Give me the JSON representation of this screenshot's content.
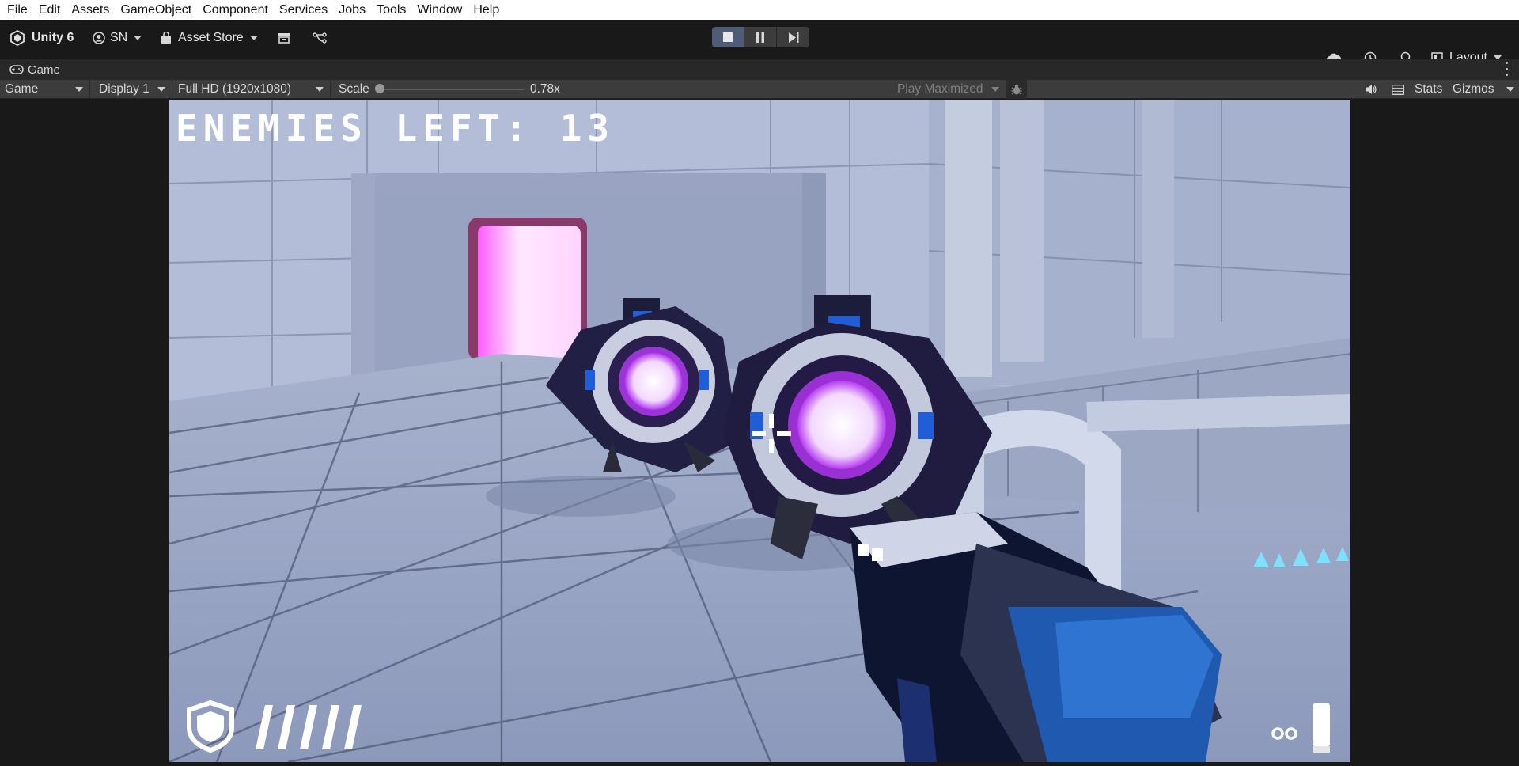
{
  "menu": [
    "File",
    "Edit",
    "Assets",
    "GameObject",
    "Component",
    "Services",
    "Jobs",
    "Tools",
    "Window",
    "Help"
  ],
  "toolbar": {
    "editor_label": "Unity 6",
    "account_label": "SN",
    "store_label": "Asset Store",
    "layout_label": "Layout",
    "play_state": "playing"
  },
  "game_tab": {
    "label": "Game"
  },
  "game_view_bar": {
    "view_mode": "Game",
    "display": "Display 1",
    "resolution": "Full HD (1920x1080)",
    "scale_label": "Scale",
    "scale_value": "0.78x",
    "scale_fraction": 0.0,
    "play_maximized": "Play Maximized",
    "stats_label": "Stats",
    "gizmos_label": "Gizmos"
  },
  "hud": {
    "enemies_left_text": "ENEMIES LEFT: 13",
    "health_segments": 5,
    "ammo_indicator": "oo"
  },
  "colors": {
    "menubar_bg": "#ffffff",
    "editor_bg": "#191919",
    "play_active": "#4e5d75",
    "scene_floor": "#8f9cbc",
    "enemy_glow": "#f3d7ff",
    "portal_glow": "#ff9cff"
  }
}
